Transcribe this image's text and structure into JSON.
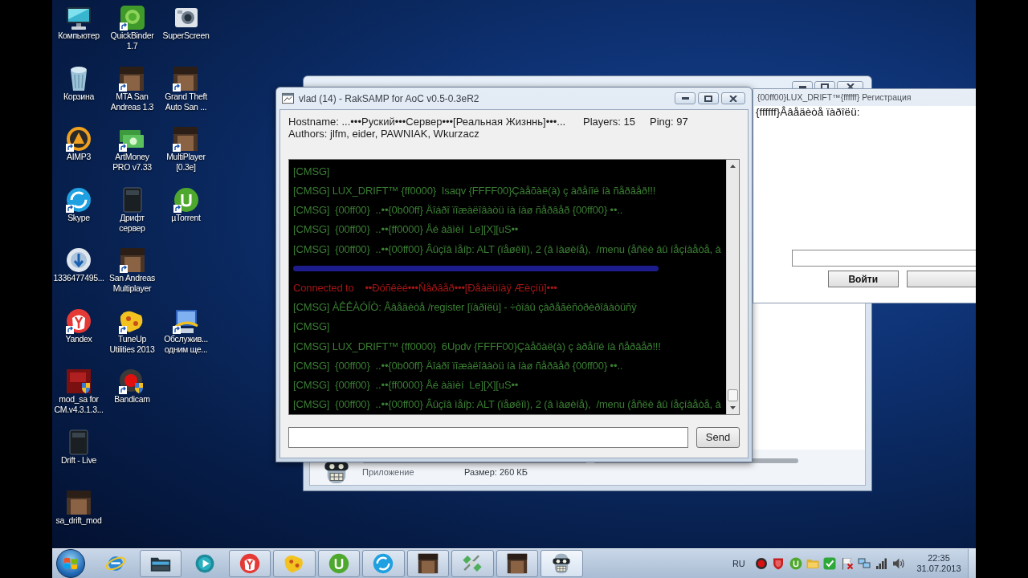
{
  "desktop": {
    "rows": [
      [
        {
          "label": "Компьютер",
          "shortcut": false
        },
        {
          "label": "QuickBinder\n1.7",
          "shortcut": true
        },
        {
          "label": "SuperScreen",
          "shortcut": false
        }
      ],
      [
        {
          "label": "Корзина",
          "shortcut": false
        },
        {
          "label": "MTA San\nAndreas 1.3",
          "shortcut": true
        },
        {
          "label": "Grand Theft\nAuto San ...",
          "shortcut": true
        }
      ],
      [
        {
          "label": "AIMP3",
          "shortcut": true
        },
        {
          "label": "ArtMoney\nPRO v7.33",
          "shortcut": true
        },
        {
          "label": "MultiPlayer\n[0.3e]",
          "shortcut": true
        }
      ],
      [
        {
          "label": "Skype",
          "shortcut": true
        },
        {
          "label": "Дрифт\nсервер",
          "shortcut": false
        },
        {
          "label": "µTorrent",
          "shortcut": true
        }
      ],
      [
        {
          "label": "1336477495...",
          "shortcut": false
        },
        {
          "label": "San Andreas\nMultiplayer",
          "shortcut": true
        }
      ],
      [
        {
          "label": "Yandex",
          "shortcut": true
        },
        {
          "label": "TuneUp\nUtilities 2013",
          "shortcut": true
        },
        {
          "label": "Обслужив...\nодним ще...",
          "shortcut": true
        }
      ],
      [
        {
          "label": "mod_sa for\nCM.v4.3.1.3...",
          "shortcut": false
        },
        {
          "label": "Bandicam",
          "shortcut": true
        }
      ],
      [
        {
          "label": "Drift - Live",
          "shortcut": false
        }
      ],
      [
        {
          "label": "sa_drift_mod",
          "shortcut": false
        }
      ]
    ]
  },
  "explorer_window": {
    "file_type": "Приложение",
    "file_size": "Размер: 260 КБ"
  },
  "chat_window": {
    "title": "vlad (14) - RakSAMP for AoC v0.5-0.3eR2",
    "hostname": "Hostname:  ...•••Руский•••Сервер•••[Реальная Жизннь]•••...",
    "players": "Players: 15",
    "ping": "Ping: 97",
    "authors": "Authors: jlfm, eider, PAWNIAK, Wkurzacz",
    "messages": [
      {
        "kind": "text",
        "text": "[CMSG]",
        "color": "#3a7d33"
      },
      {
        "kind": "text",
        "text": "[CMSG] LUX_DRIFT™ {ff0000}  Isaqv {FFFF00}Çàåõàë(à) ç àðåíîé íà ñåðâåð!!!",
        "color": "#3a7d33"
      },
      {
        "kind": "text",
        "text": "[CMSG]  {00ff00}  ..••{0b00ff} Äîáðî ïîæàëîâàòü íà íàø ñåðâåð {00ff00} ••..",
        "color": "#3a7d33"
      },
      {
        "kind": "text",
        "text": "[CMSG]  {00ff00}  ..••{ff0000} Åé àäìèí  Le][X][uS••",
        "color": "#3a7d33"
      },
      {
        "kind": "text",
        "text": "[CMSG]  {00ff00}  ..••{00ff00} Âûçîâ ìåíþ: ALT (ïåøêîì), 2 (â ìàøèíå),  /menu (åñëè âû íåçíàåòå, à",
        "color": "#3a7d33"
      },
      {
        "kind": "blurred",
        "color": "#1c1c8c"
      },
      {
        "kind": "text",
        "text": "Connected to    ••Ðóñêèé•••Ñåðâåð•••[Ðåàëüíàÿ Æèçíü]•••",
        "color": "#a31515"
      },
      {
        "kind": "text",
        "text": "[CMSG] ÀÊÊÀÓÍÒ: Ââåäèòå /register [ïàðîëü] - ÷òîáû çàðåãèñòðèðîâàòüñÿ",
        "color": "#3a7d33"
      },
      {
        "kind": "text",
        "text": "[CMSG]",
        "color": "#3a7d33"
      },
      {
        "kind": "text",
        "text": "[CMSG] LUX_DRIFT™ {ff0000}  6Updv {FFFF00}Çàåõàë(à) ç àðåíîé íà ñåðâåð!!!",
        "color": "#3a7d33"
      },
      {
        "kind": "text",
        "text": "[CMSG]  {00ff00}  ..••{0b00ff} Äîáðî ïîæàëîâàòü íà íàø ñåðâåð {00ff00} ••..",
        "color": "#3a7d33"
      },
      {
        "kind": "text",
        "text": "[CMSG]  {00ff00}  ..••{ff0000} Åé àäìèí  Le][X][uS••",
        "color": "#3a7d33"
      },
      {
        "kind": "text",
        "text": "[CMSG]  {00ff00}  ..••{00ff00} Âûçîâ ìåíþ: ALT (ïåøêîì), 2 (â ìàøèíå),  /menu (åñëè âû íåçíàåòå, à",
        "color": "#3a7d33"
      }
    ],
    "send_button": "Send"
  },
  "registration_dialog": {
    "title": "{00ff00}LUX_DRIFT™{ffffff} Регистрация",
    "prompt": "{ffffff}Ââåäèòå ïàðîëü:",
    "login_button": "Войти"
  },
  "taskbar": {
    "items": [
      {
        "running": false,
        "selected": false
      },
      {
        "running": true,
        "selected": false
      },
      {
        "running": false,
        "selected": false
      },
      {
        "running": true,
        "selected": false
      },
      {
        "running": true,
        "selected": false
      },
      {
        "running": true,
        "selected": false
      },
      {
        "running": true,
        "selected": false
      },
      {
        "running": true,
        "selected": false
      },
      {
        "running": true,
        "selected": false
      },
      {
        "running": true,
        "selected": false
      },
      {
        "running": true,
        "selected": true
      }
    ],
    "language": "RU",
    "time": "22:35",
    "date": "31.07.2013"
  }
}
